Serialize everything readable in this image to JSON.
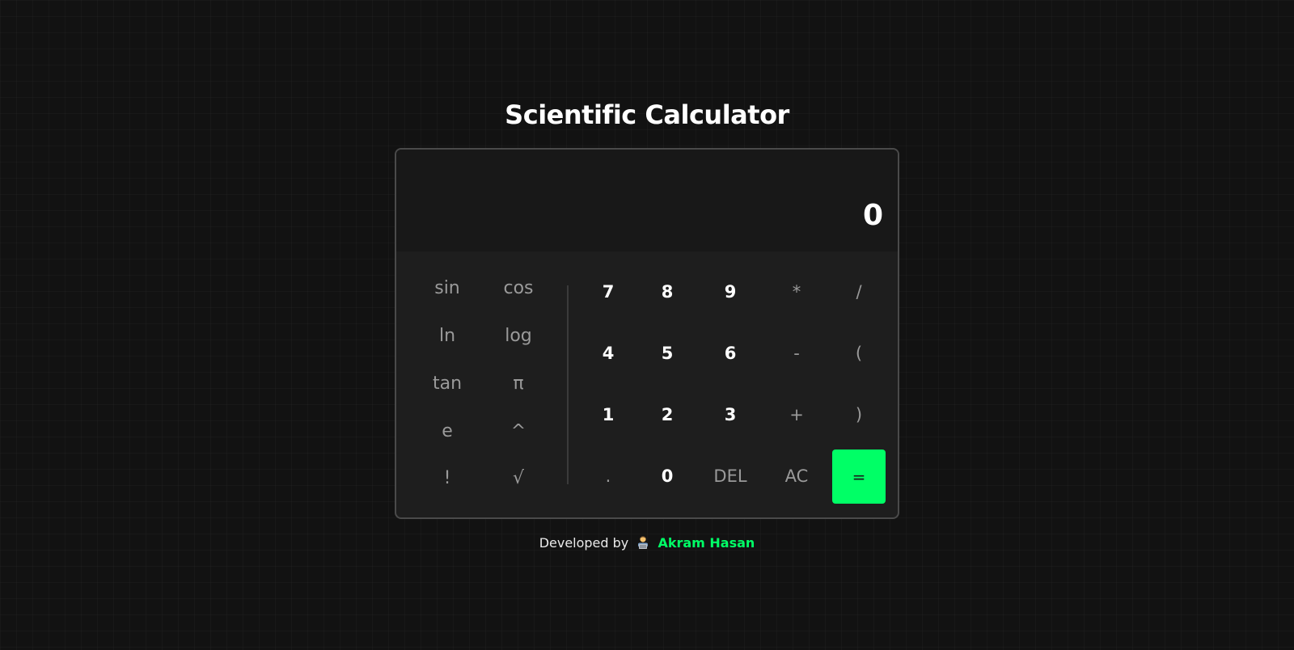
{
  "page": {
    "title": "Scientific Calculator"
  },
  "display": {
    "value": "0"
  },
  "scientific_keys": [
    "sin",
    "cos",
    "ln",
    "log",
    "tan",
    "π",
    "e",
    "^",
    "!",
    "√"
  ],
  "main_keys": {
    "row1": [
      "7",
      "8",
      "9",
      "*",
      "/"
    ],
    "row2": [
      "4",
      "5",
      "6",
      "-",
      "("
    ],
    "row3": [
      "1",
      "2",
      "3",
      "+",
      ")"
    ],
    "row4": [
      ".",
      "0",
      "DEL",
      "AC",
      "="
    ]
  },
  "footer": {
    "prefix": "Developed by",
    "emoji_icon": "technologist-icon",
    "author": "Akram Hasan"
  },
  "colors": {
    "background": "#121212",
    "accent": "#00ff66",
    "muted_text": "#9a9a9a",
    "panel": "#1e1e1e",
    "display_bg": "#181818"
  }
}
